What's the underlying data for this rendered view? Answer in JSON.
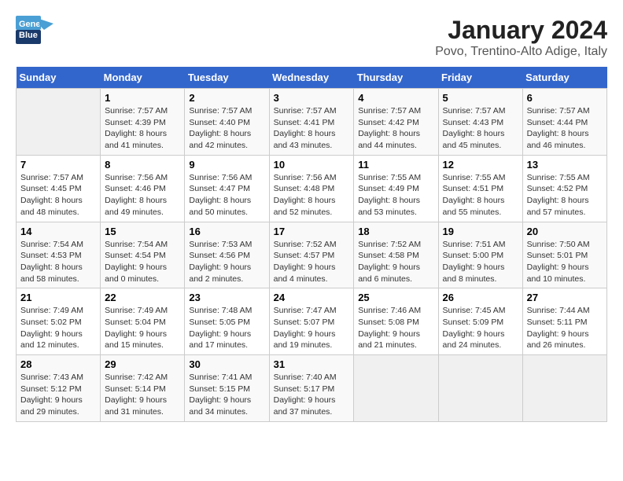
{
  "logo": {
    "line1": "General",
    "line2": "Blue"
  },
  "title": "January 2024",
  "subtitle": "Povo, Trentino-Alto Adige, Italy",
  "days_of_week": [
    "Sunday",
    "Monday",
    "Tuesday",
    "Wednesday",
    "Thursday",
    "Friday",
    "Saturday"
  ],
  "weeks": [
    [
      {
        "day": "",
        "empty": true
      },
      {
        "day": "1",
        "sunrise": "7:57 AM",
        "sunset": "4:39 PM",
        "daylight": "8 hours and 41 minutes."
      },
      {
        "day": "2",
        "sunrise": "7:57 AM",
        "sunset": "4:40 PM",
        "daylight": "8 hours and 42 minutes."
      },
      {
        "day": "3",
        "sunrise": "7:57 AM",
        "sunset": "4:41 PM",
        "daylight": "8 hours and 43 minutes."
      },
      {
        "day": "4",
        "sunrise": "7:57 AM",
        "sunset": "4:42 PM",
        "daylight": "8 hours and 44 minutes."
      },
      {
        "day": "5",
        "sunrise": "7:57 AM",
        "sunset": "4:43 PM",
        "daylight": "8 hours and 45 minutes."
      },
      {
        "day": "6",
        "sunrise": "7:57 AM",
        "sunset": "4:44 PM",
        "daylight": "8 hours and 46 minutes."
      }
    ],
    [
      {
        "day": "7",
        "sunrise": "7:57 AM",
        "sunset": "4:45 PM",
        "daylight": "8 hours and 48 minutes."
      },
      {
        "day": "8",
        "sunrise": "7:56 AM",
        "sunset": "4:46 PM",
        "daylight": "8 hours and 49 minutes."
      },
      {
        "day": "9",
        "sunrise": "7:56 AM",
        "sunset": "4:47 PM",
        "daylight": "8 hours and 50 minutes."
      },
      {
        "day": "10",
        "sunrise": "7:56 AM",
        "sunset": "4:48 PM",
        "daylight": "8 hours and 52 minutes."
      },
      {
        "day": "11",
        "sunrise": "7:55 AM",
        "sunset": "4:49 PM",
        "daylight": "8 hours and 53 minutes."
      },
      {
        "day": "12",
        "sunrise": "7:55 AM",
        "sunset": "4:51 PM",
        "daylight": "8 hours and 55 minutes."
      },
      {
        "day": "13",
        "sunrise": "7:55 AM",
        "sunset": "4:52 PM",
        "daylight": "8 hours and 57 minutes."
      }
    ],
    [
      {
        "day": "14",
        "sunrise": "7:54 AM",
        "sunset": "4:53 PM",
        "daylight": "8 hours and 58 minutes."
      },
      {
        "day": "15",
        "sunrise": "7:54 AM",
        "sunset": "4:54 PM",
        "daylight": "9 hours and 0 minutes."
      },
      {
        "day": "16",
        "sunrise": "7:53 AM",
        "sunset": "4:56 PM",
        "daylight": "9 hours and 2 minutes."
      },
      {
        "day": "17",
        "sunrise": "7:52 AM",
        "sunset": "4:57 PM",
        "daylight": "9 hours and 4 minutes."
      },
      {
        "day": "18",
        "sunrise": "7:52 AM",
        "sunset": "4:58 PM",
        "daylight": "9 hours and 6 minutes."
      },
      {
        "day": "19",
        "sunrise": "7:51 AM",
        "sunset": "5:00 PM",
        "daylight": "9 hours and 8 minutes."
      },
      {
        "day": "20",
        "sunrise": "7:50 AM",
        "sunset": "5:01 PM",
        "daylight": "9 hours and 10 minutes."
      }
    ],
    [
      {
        "day": "21",
        "sunrise": "7:49 AM",
        "sunset": "5:02 PM",
        "daylight": "9 hours and 12 minutes."
      },
      {
        "day": "22",
        "sunrise": "7:49 AM",
        "sunset": "5:04 PM",
        "daylight": "9 hours and 15 minutes."
      },
      {
        "day": "23",
        "sunrise": "7:48 AM",
        "sunset": "5:05 PM",
        "daylight": "9 hours and 17 minutes."
      },
      {
        "day": "24",
        "sunrise": "7:47 AM",
        "sunset": "5:07 PM",
        "daylight": "9 hours and 19 minutes."
      },
      {
        "day": "25",
        "sunrise": "7:46 AM",
        "sunset": "5:08 PM",
        "daylight": "9 hours and 21 minutes."
      },
      {
        "day": "26",
        "sunrise": "7:45 AM",
        "sunset": "5:09 PM",
        "daylight": "9 hours and 24 minutes."
      },
      {
        "day": "27",
        "sunrise": "7:44 AM",
        "sunset": "5:11 PM",
        "daylight": "9 hours and 26 minutes."
      }
    ],
    [
      {
        "day": "28",
        "sunrise": "7:43 AM",
        "sunset": "5:12 PM",
        "daylight": "9 hours and 29 minutes."
      },
      {
        "day": "29",
        "sunrise": "7:42 AM",
        "sunset": "5:14 PM",
        "daylight": "9 hours and 31 minutes."
      },
      {
        "day": "30",
        "sunrise": "7:41 AM",
        "sunset": "5:15 PM",
        "daylight": "9 hours and 34 minutes."
      },
      {
        "day": "31",
        "sunrise": "7:40 AM",
        "sunset": "5:17 PM",
        "daylight": "9 hours and 37 minutes."
      },
      {
        "day": "",
        "empty": true
      },
      {
        "day": "",
        "empty": true
      },
      {
        "day": "",
        "empty": true
      }
    ]
  ]
}
